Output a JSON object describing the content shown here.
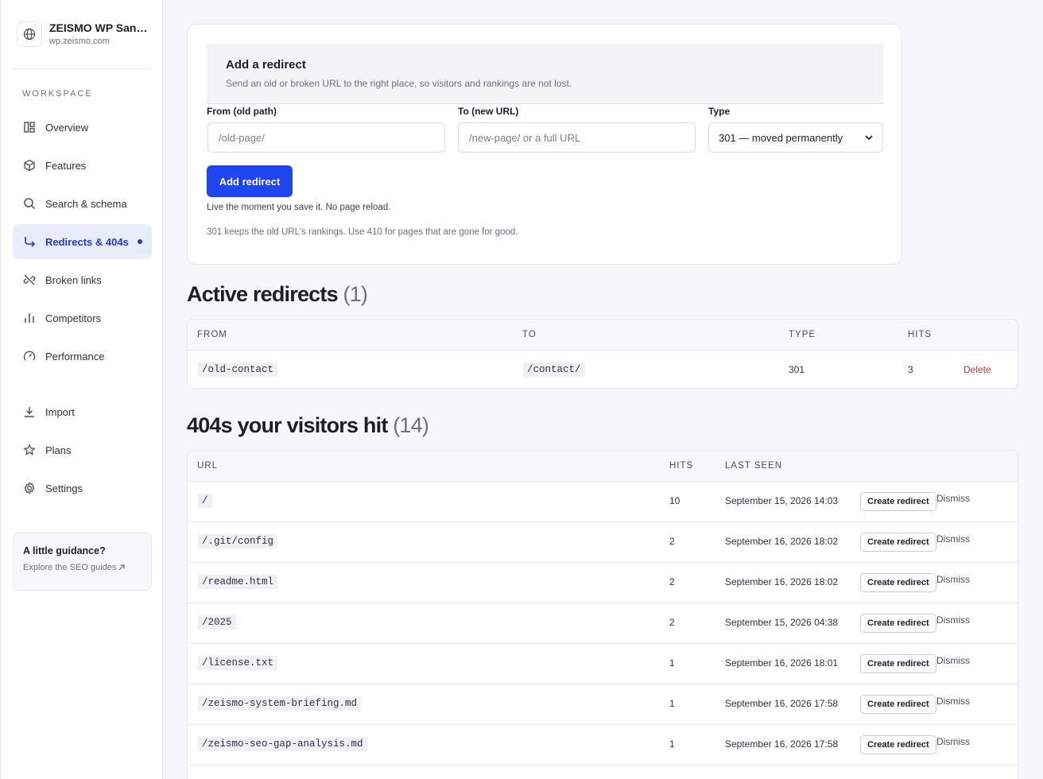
{
  "site": {
    "name": "ZEISMO WP Sandbox",
    "url": "wp.zeismo.com",
    "logo_icon": "globe-icon"
  },
  "sidebar": {
    "section_label": "WORKSPACE",
    "items": [
      {
        "label": "Overview",
        "icon": "layout-icon"
      },
      {
        "label": "Features",
        "icon": "cube-icon"
      },
      {
        "label": "Search & schema",
        "icon": "search-icon"
      },
      {
        "label": "Redirects & 404s",
        "icon": "redirect-arrow-icon",
        "active": true
      },
      {
        "label": "Broken links",
        "icon": "broken-link-icon"
      },
      {
        "label": "Competitors",
        "icon": "bar-chart-icon"
      },
      {
        "label": "Performance",
        "icon": "gauge-icon"
      },
      {
        "label": "Import",
        "icon": "download-icon"
      },
      {
        "label": "Plans",
        "icon": "star-icon"
      },
      {
        "label": "Settings",
        "icon": "gear-icon"
      }
    ],
    "guide": {
      "title": "A little guidance?",
      "link": "Explore the SEO guides"
    }
  },
  "add_redirect": {
    "title": "Add a redirect",
    "subtitle": "Send an old or broken URL to the right place, so visitors and rankings are not lost.",
    "from_label": "From (old path)",
    "from_placeholder": "/old-page/",
    "to_label": "To (new URL)",
    "to_placeholder": "/new-page/ or a full URL",
    "type_label": "Type",
    "type_value": "301 — moved permanently",
    "button": "Add redirect",
    "hint_live": "Live the moment you save it. No page reload.",
    "hint_type": "301 keeps the old URL's rankings. Use 410 for pages that are gone for good."
  },
  "active": {
    "title": "Active redirects",
    "count": "(1)",
    "columns": [
      "FROM",
      "TO",
      "TYPE",
      "HITS"
    ],
    "rows": [
      {
        "from": "/old-contact",
        "to": "/contact/",
        "type": "301",
        "hits": "3",
        "action": "Delete"
      }
    ]
  },
  "notfound": {
    "title": "404s your visitors hit",
    "count": "(14)",
    "columns": [
      "URL",
      "HITS",
      "LAST SEEN"
    ],
    "create_label": "Create redirect",
    "dismiss_label": "Dismiss",
    "rows": [
      {
        "url": "/",
        "hits": "10",
        "last_seen": "September 15, 2026 14:03"
      },
      {
        "url": "/.git/config",
        "hits": "2",
        "last_seen": "September 16, 2026 18:02"
      },
      {
        "url": "/readme.html",
        "hits": "2",
        "last_seen": "September 16, 2026 18:02"
      },
      {
        "url": "/2025",
        "hits": "2",
        "last_seen": "September 15, 2026 04:38"
      },
      {
        "url": "/license.txt",
        "hits": "1",
        "last_seen": "September 16, 2026 18:01"
      },
      {
        "url": "/zeismo-system-briefing.md",
        "hits": "1",
        "last_seen": "September 16, 2026 17:58"
      },
      {
        "url": "/zeismo-seo-gap-analysis.md",
        "hits": "1",
        "last_seen": "September 16, 2026 17:58"
      }
    ]
  }
}
